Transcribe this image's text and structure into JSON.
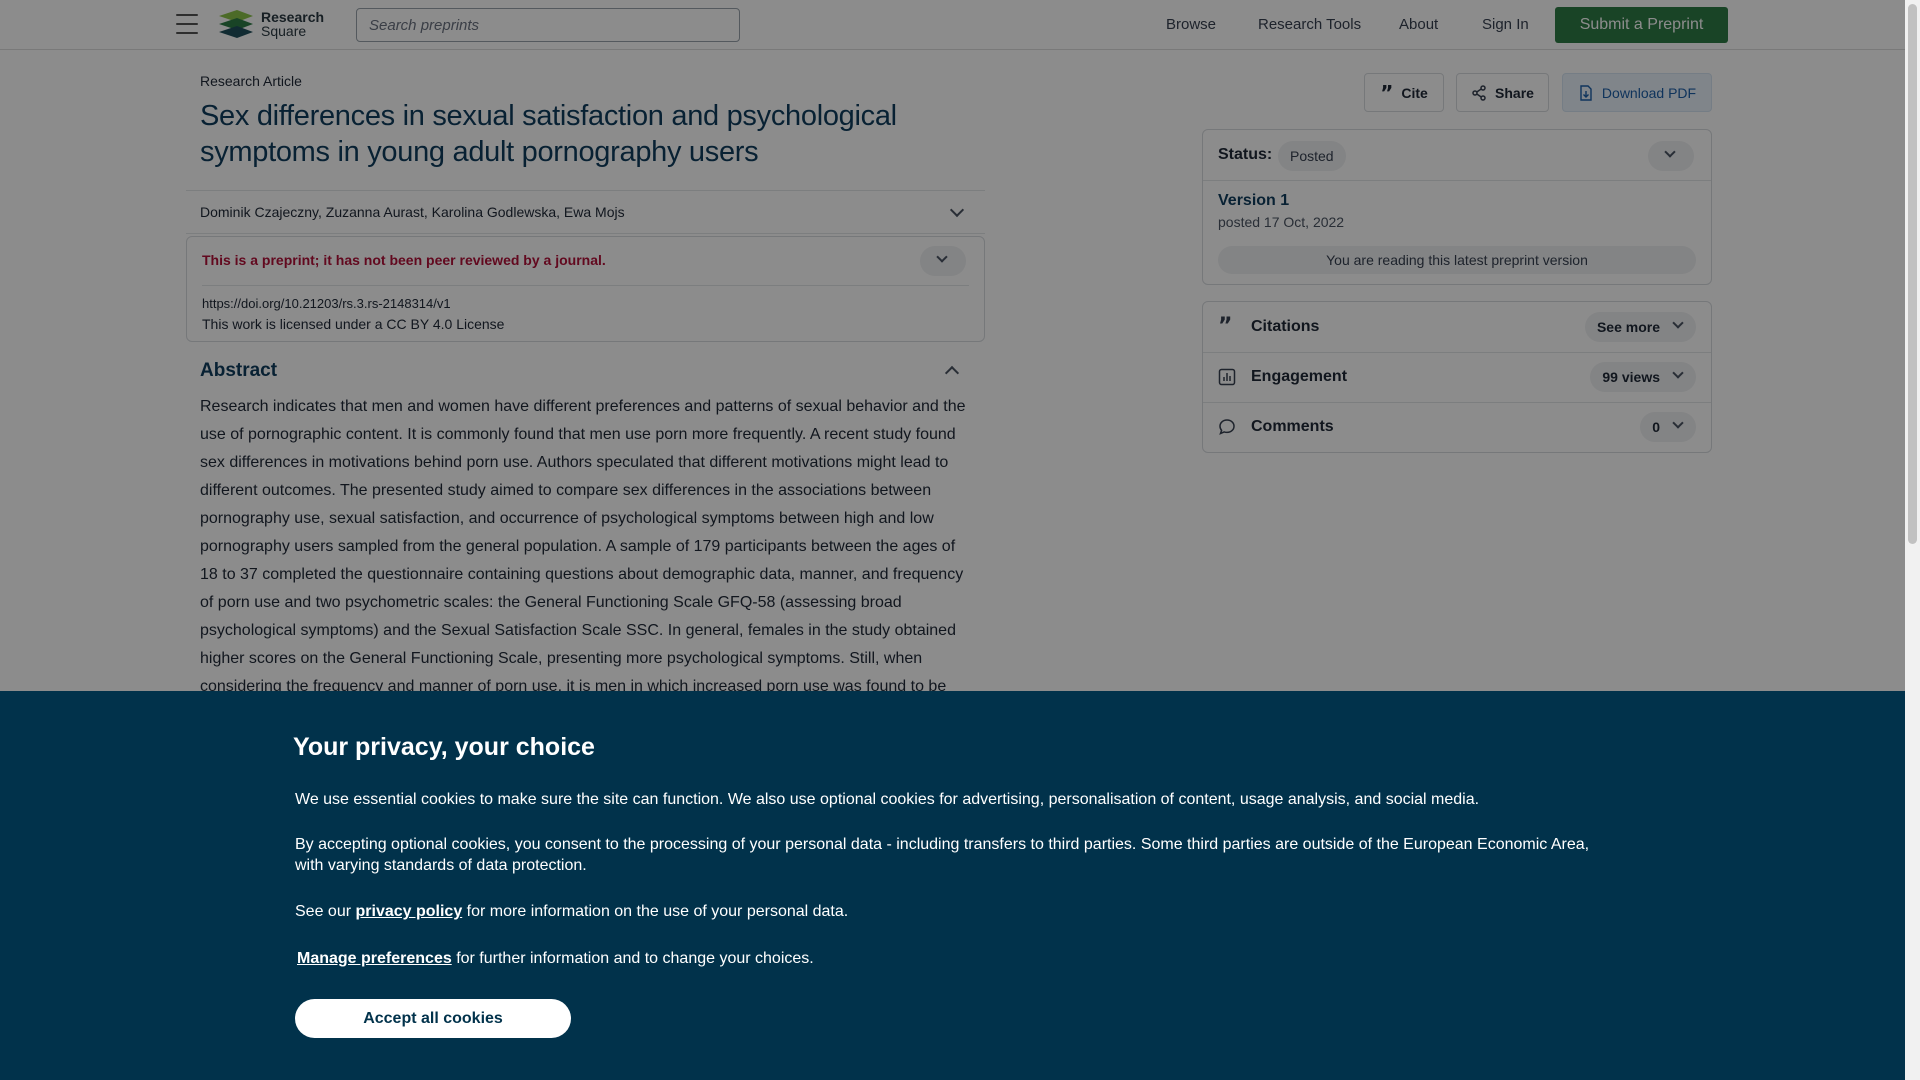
{
  "header": {
    "logo_line1": "Research",
    "logo_line2": "Square",
    "search_placeholder": "Search preprints",
    "nav": [
      "Browse",
      "Research Tools",
      "About",
      "Sign In"
    ],
    "submit_label": "Submit a Preprint",
    "brand_color": "#2e7d46"
  },
  "article": {
    "type": "Research Article",
    "title": "Sex differences in sexual satisfaction and psychological symptoms in young adult pornography users",
    "authors": "Dominik Czajeczny, Zuzanna Aurast, Karolina Godlewska, Ewa Mojs",
    "preprint_warning": "This is a preprint; it has not been peer reviewed by a journal.",
    "doi": "https://doi.org/10.21203/rs.3.rs-2148314/v1",
    "license": "This work is licensed under a CC BY 4.0 License",
    "abstract_title": "Abstract",
    "abstract_text": "Research indicates that men and women have different preferences and patterns of sexual behavior and the use of pornographic content. It is commonly found that men use porn more frequently. A recent study found sex differences in motivations behind porn use. Authors speculated that different motivations might lead to different outcomes. The presented study aimed to compare sex differences in the associations between pornography use, sexual satisfaction, and occurrence of psychological symptoms between high and low pornography users sampled from the general population. A sample of 179 participants between the ages of 18 to 37 completed the questionnaire containing questions about demographic data, manner, and frequency of porn use and two psychometric scales: the General Functioning Scale GFQ-58 (assessing broad psychological symptoms) and the Sexual Satisfaction Scale SSC. In general, females in the study obtained higher scores on the General Functioning Scale, presenting more psychological symptoms. Still, when considering the frequency and manner of porn use, it is men in which increased porn use was found to be"
  },
  "actions": {
    "cite": "Cite",
    "share": "Share",
    "download": "Download PDF"
  },
  "status_card": {
    "label": "Status:",
    "badge": "Posted",
    "version": "Version 1",
    "posted": "posted 17 Oct, 2022",
    "latest": "You are reading this latest preprint version"
  },
  "metrics": {
    "citations_label": "Citations",
    "citations_value": "See more",
    "engagement_label": "Engagement",
    "engagement_value": "99 views",
    "comments_label": "Comments",
    "comments_value": "0"
  },
  "cookie": {
    "title": "Your privacy, your choice",
    "p1": "We use essential cookies to make sure the site can function. We also use optional cookies for advertising, personalisation of content, usage analysis, and social media.",
    "p2": "By accepting optional cookies, you consent to the processing of your personal data - including transfers to third parties. Some third parties are outside of the European Economic Area, with varying standards of data protection.",
    "p3_before": "See our",
    "p3_link": "privacy policy",
    "p3_after": "for more information on the use of your personal data.",
    "p4_link": "Manage preferences",
    "p4_after": "for further information and to change your choices.",
    "accept": "Accept all cookies",
    "background_color": "#01324b"
  }
}
